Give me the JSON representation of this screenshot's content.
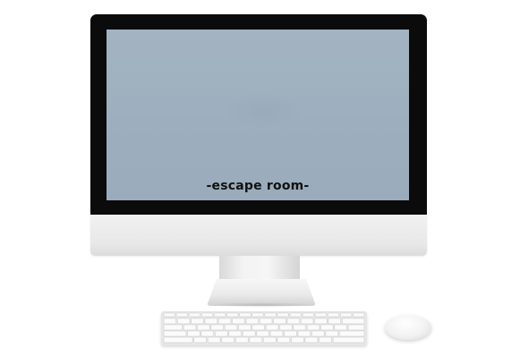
{
  "screen": {
    "caption": "-escape room-"
  },
  "colors": {
    "bezel": "#0b0b0c",
    "screen": "#9dafbe",
    "aluminum": "#e8e8e8",
    "caption_text": "#111111"
  },
  "icons": {
    "monitor": "desktop-computer-icon",
    "keyboard": "keyboard-icon",
    "mouse": "mouse-icon"
  }
}
